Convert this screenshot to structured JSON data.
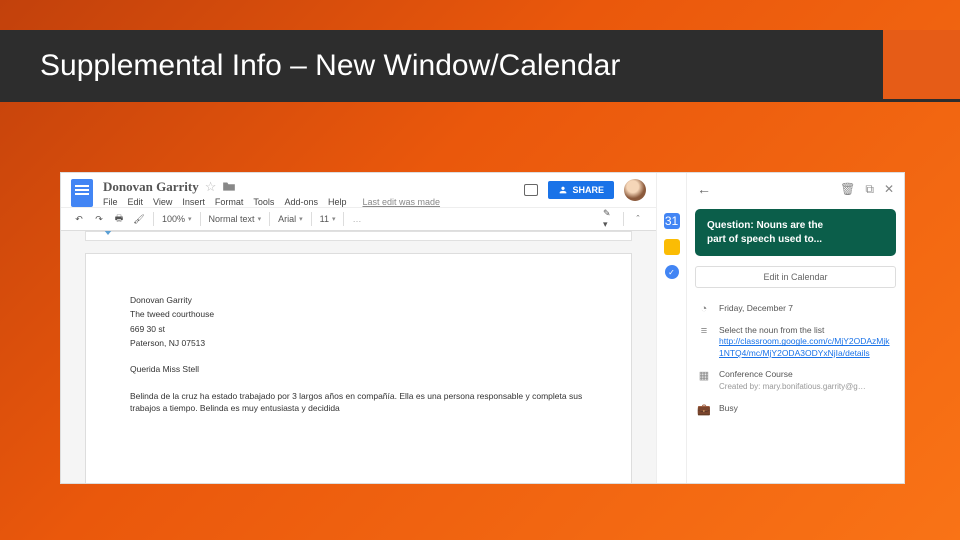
{
  "slide": {
    "title": "Supplemental Info – New Window/Calendar"
  },
  "docs": {
    "title": "Donovan Garrity",
    "menus": [
      "File",
      "Edit",
      "View",
      "Insert",
      "Format",
      "Tools",
      "Add-ons",
      "Help"
    ],
    "last_edit": "Last edit was made",
    "share": "SHARE",
    "toolbar": {
      "zoom": "100%",
      "style": "Normal text",
      "font": "Arial",
      "size": "11"
    },
    "body": {
      "name": "Donovan Garrity",
      "addr1": "The tweed courthouse",
      "addr2": "669 30 st",
      "addr3": "Paterson, NJ 07513",
      "greeting": "Querida Miss Stell",
      "para": "Belinda de la cruz ha estado trabajado por 3 largos años en compañía. Ella es una persona responsable y completa sus trabajos a tiempo. Belinda es muy entusiasta y decidida"
    }
  },
  "calendar": {
    "card_line1": "Question: Nouns are the",
    "card_line2": "part of speech used to...",
    "edit_btn": "Edit in Calendar",
    "date": "Friday, December 7",
    "desc_text": "Select the noun from the list",
    "desc_link": "http://classroom.google.com/c/MjY2ODAzMjk1NTQ4/mc/MjY2ODA3ODYxNjIa/details",
    "course": "Conference Course",
    "creator": "Created by: mary.bonifatious.garrity@g…",
    "busy": "Busy"
  }
}
